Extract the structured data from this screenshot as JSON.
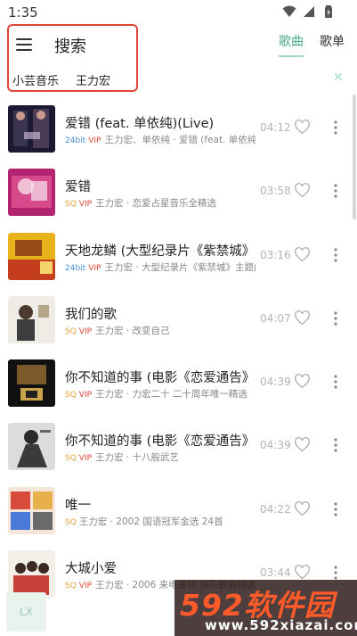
{
  "status_bar": {
    "time": "1:35",
    "icons": [
      "wifi-icon",
      "signal-icon",
      "battery-icon"
    ]
  },
  "header": {
    "title": "搜索",
    "keywords": [
      "小芸音乐",
      "王力宏"
    ],
    "tabs": [
      {
        "label": "歌曲",
        "active": true
      },
      {
        "label": "歌单",
        "active": false
      }
    ]
  },
  "songs": [
    {
      "title": "爱错 (feat. 单依纯)(Live)",
      "quality": "24bit",
      "vip": "VIP",
      "artist_album": "王力宏、单依纯 · 爱错 (feat. 单依纯)(Live)",
      "duration": "04:12"
    },
    {
      "title": "爱错",
      "quality": "SQ",
      "vip": "VIP",
      "artist_album": "王力宏 · 恋爱占星音乐全精选",
      "duration": "03:58"
    },
    {
      "title": "天地龙鳞 (大型纪录片《紫禁城》主题曲)",
      "quality": "24bit",
      "vip": "VIP",
      "artist_album": "王力宏 · 大型纪录片《紫禁城》主题曲",
      "duration": "03:16"
    },
    {
      "title": "我们的歌",
      "quality": "SQ",
      "vip": "VIP",
      "artist_album": "王力宏 · 改变自己",
      "duration": "04:07"
    },
    {
      "title": "你不知道的事 (电影《恋爱通告》主题曲)",
      "quality": "SQ",
      "vip": "VIP",
      "artist_album": "王力宏 · 力宏二十 二十周年唯一精选",
      "duration": "04:39"
    },
    {
      "title": "你不知道的事 (电影《恋爱通告》主题曲)",
      "quality": "SQ",
      "vip": "VIP",
      "artist_album": "王力宏 · 十八般武艺",
      "duration": "04:39"
    },
    {
      "title": "唯一",
      "quality": "SQ",
      "vip": "",
      "artist_album": "王力宏 · 2002 国语冠军金选 24首",
      "duration": "04:22"
    },
    {
      "title": "大城小爱",
      "quality": "SQ",
      "vip": "VIP",
      "artist_album": "王力宏 · 2006 来电答铃 快乐歌曲精选",
      "duration": "03:44"
    }
  ],
  "floating_badge": "LX",
  "watermark": {
    "main": "592软件园",
    "sub": "www.592xiazai.com"
  },
  "colors": {
    "accent": "#4aa88a",
    "vip": "#e0453a",
    "sq": "#e6a23c",
    "hires": "#4a8fd6",
    "highlight_box": "#e0453a"
  }
}
